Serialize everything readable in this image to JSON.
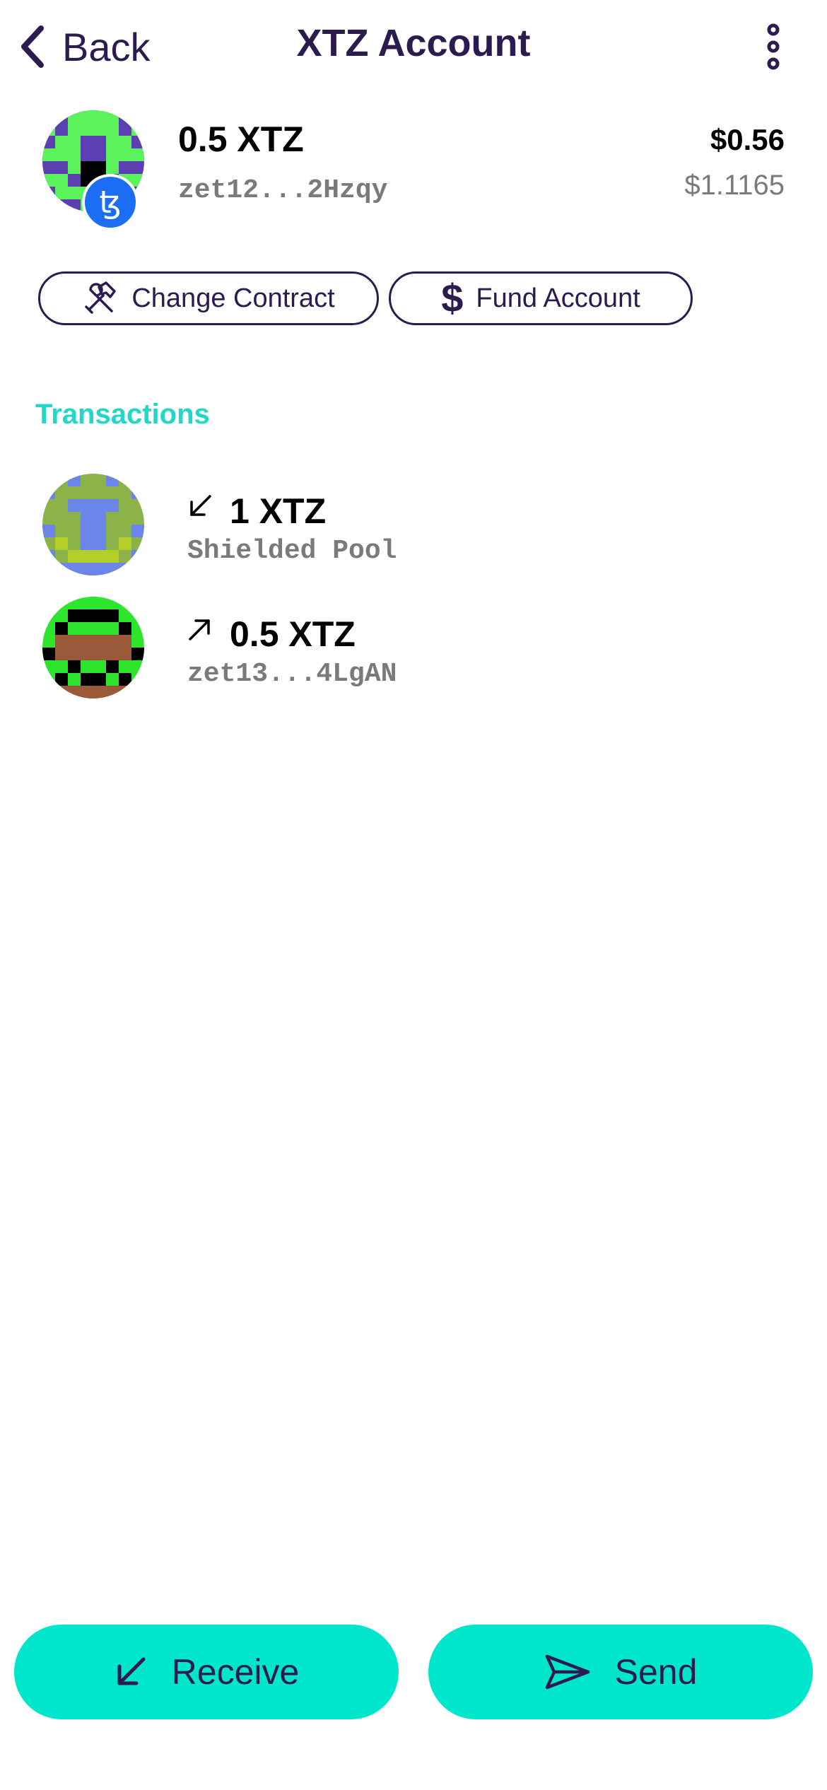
{
  "header": {
    "back_label": "Back",
    "title": "XTZ Account"
  },
  "account": {
    "balance": "0.5 XTZ",
    "address": "zet12...2Hzqy",
    "fiat_value": "$0.56",
    "unit_price": "$1.1165",
    "badge_glyph": "ꜩ"
  },
  "actions": {
    "change_contract_label": "Change Contract",
    "fund_account_label": "Fund Account",
    "fund_icon_glyph": "$"
  },
  "transactions": {
    "heading": "Transactions",
    "items": [
      {
        "direction": "incoming",
        "amount": "1 XTZ",
        "counterparty": "Shielded Pool"
      },
      {
        "direction": "outgoing",
        "amount": "0.5 XTZ",
        "counterparty": "zet13...4LgAN"
      }
    ]
  },
  "bottom": {
    "receive_label": "Receive",
    "send_label": "Send"
  },
  "colors": {
    "accent": "#00e6cc",
    "heading_teal": "#1fd8c8",
    "dark_purple": "#2b1b4f",
    "tezos_blue": "#1b6ef3",
    "muted_gray": "#7a7a7a"
  },
  "icons": [
    "chevron-left-icon",
    "more-vertical-icon",
    "tezos-icon",
    "tools-icon",
    "dollar-icon",
    "arrow-down-left-icon",
    "arrow-up-right-icon",
    "send-icon"
  ]
}
